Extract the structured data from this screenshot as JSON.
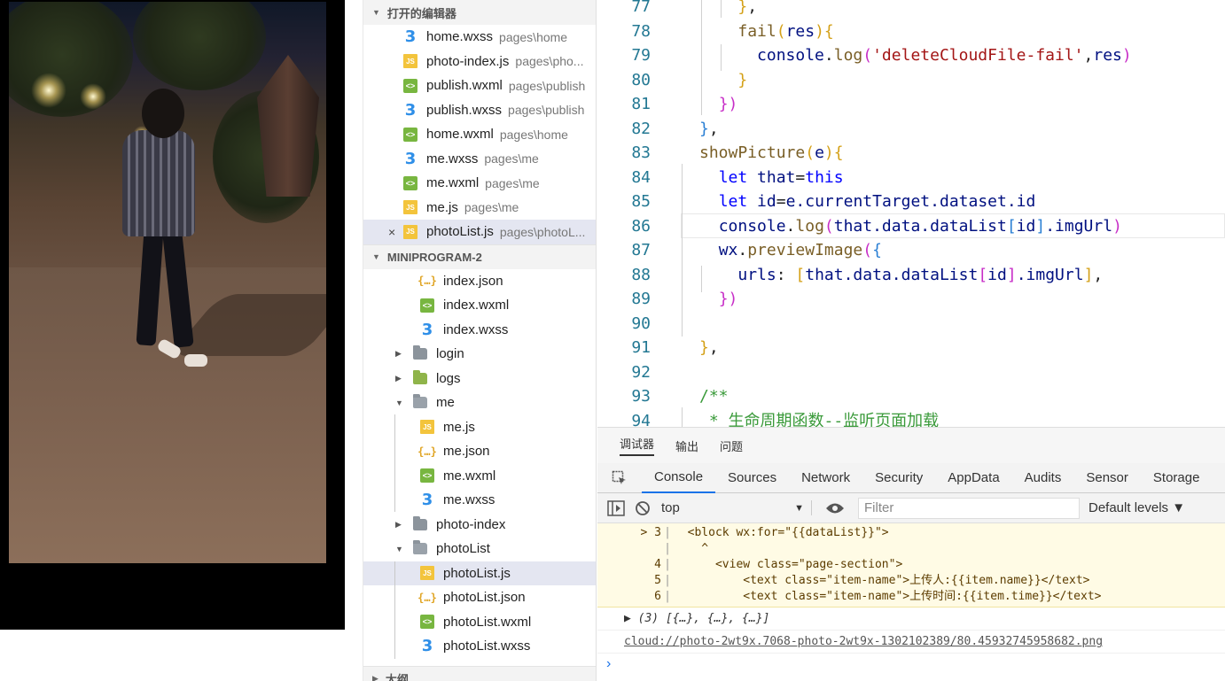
{
  "explorer": {
    "open_editors_label": "打开的编辑器",
    "open_editors": [
      {
        "name": "home.wxss",
        "path": "pages\\home",
        "type": "css"
      },
      {
        "name": "photo-index.js",
        "path": "pages\\pho...",
        "type": "js"
      },
      {
        "name": "publish.wxml",
        "path": "pages\\publish",
        "type": "wxml"
      },
      {
        "name": "publish.wxss",
        "path": "pages\\publish",
        "type": "css"
      },
      {
        "name": "home.wxml",
        "path": "pages\\home",
        "type": "wxml"
      },
      {
        "name": "me.wxss",
        "path": "pages\\me",
        "type": "css"
      },
      {
        "name": "me.wxml",
        "path": "pages\\me",
        "type": "wxml"
      },
      {
        "name": "me.js",
        "path": "pages\\me",
        "type": "js"
      },
      {
        "name": "photoList.js",
        "path": "pages\\photoL...",
        "type": "js",
        "active": true,
        "close": "×"
      }
    ],
    "project_label": "MINIPROGRAM-2",
    "tree": [
      {
        "name": "index.json",
        "type": "json",
        "depth": 2
      },
      {
        "name": "index.wxml",
        "type": "wxml",
        "depth": 2
      },
      {
        "name": "index.wxss",
        "type": "css",
        "depth": 2
      },
      {
        "name": "login",
        "type": "folder",
        "depth": 1,
        "twisty": "▶"
      },
      {
        "name": "logs",
        "type": "logs",
        "depth": 1,
        "twisty": "▶"
      },
      {
        "name": "me",
        "type": "folder-open",
        "depth": 1,
        "twisty": "▼"
      },
      {
        "name": "me.js",
        "type": "js",
        "depth": 2
      },
      {
        "name": "me.json",
        "type": "json",
        "depth": 2
      },
      {
        "name": "me.wxml",
        "type": "wxml",
        "depth": 2
      },
      {
        "name": "me.wxss",
        "type": "css",
        "depth": 2
      },
      {
        "name": "photo-index",
        "type": "folder",
        "depth": 1,
        "twisty": "▶"
      },
      {
        "name": "photoList",
        "type": "folder-open",
        "depth": 1,
        "twisty": "▼"
      },
      {
        "name": "photoList.js",
        "type": "js",
        "depth": 2,
        "selected": true
      },
      {
        "name": "photoList.json",
        "type": "json",
        "depth": 2
      },
      {
        "name": "photoList.wxml",
        "type": "wxml",
        "depth": 2
      },
      {
        "name": "photoList.wxss",
        "type": "css",
        "depth": 2
      }
    ],
    "outline_label": "大纲"
  },
  "editor": {
    "lines": [
      {
        "n": "77",
        "tokens": [
          [
            "    ",
            "t"
          ],
          [
            "}",
            "b1"
          ],
          [
            ",",
            "t"
          ]
        ]
      },
      {
        "n": "78",
        "tokens": [
          [
            "    ",
            "t"
          ],
          [
            "fail",
            "f"
          ],
          [
            "(",
            "b1"
          ],
          [
            "res",
            "p"
          ],
          [
            "){",
            "b1"
          ]
        ]
      },
      {
        "n": "79",
        "tokens": [
          [
            "      ",
            "t"
          ],
          [
            "console",
            "p"
          ],
          [
            ".",
            "t"
          ],
          [
            "log",
            "f"
          ],
          [
            "(",
            "b2"
          ],
          [
            "'deleteCloudFile-fail'",
            "s"
          ],
          [
            ",",
            "t"
          ],
          [
            "res",
            "p"
          ],
          [
            ")",
            "b2"
          ]
        ]
      },
      {
        "n": "80",
        "tokens": [
          [
            "    ",
            "t"
          ],
          [
            "}",
            "b1"
          ]
        ]
      },
      {
        "n": "81",
        "tokens": [
          [
            "  ",
            "t"
          ],
          [
            "})",
            "b2"
          ]
        ]
      },
      {
        "n": "82",
        "tokens": [
          [
            "}",
            "b3"
          ],
          [
            ",",
            "t"
          ]
        ]
      },
      {
        "n": "83",
        "tokens": [
          [
            "showPicture",
            "f"
          ],
          [
            "(",
            "b1"
          ],
          [
            "e",
            "p"
          ],
          [
            "){",
            "b1"
          ]
        ]
      },
      {
        "n": "84",
        "tokens": [
          [
            "  ",
            "t"
          ],
          [
            "let ",
            "k"
          ],
          [
            "that",
            "p"
          ],
          [
            "=",
            "t"
          ],
          [
            "this",
            "k"
          ]
        ]
      },
      {
        "n": "85",
        "tokens": [
          [
            "  ",
            "t"
          ],
          [
            "let ",
            "k"
          ],
          [
            "id",
            "p"
          ],
          [
            "=",
            "t"
          ],
          [
            "e",
            "p"
          ],
          [
            ".currentTarget.dataset.id",
            "p"
          ]
        ]
      },
      {
        "n": "86",
        "tokens": [
          [
            "  ",
            "t"
          ],
          [
            "console",
            "p"
          ],
          [
            ".",
            "t"
          ],
          [
            "log",
            "f"
          ],
          [
            "(",
            "b2"
          ],
          [
            "that.data.dataList",
            "p"
          ],
          [
            "[",
            "b3"
          ],
          [
            "id",
            "p"
          ],
          [
            "]",
            "b3"
          ],
          [
            ".imgUrl",
            "p"
          ],
          [
            ")",
            "b2"
          ]
        ]
      },
      {
        "n": "87",
        "tokens": [
          [
            "  ",
            "t"
          ],
          [
            "wx",
            "p"
          ],
          [
            ".",
            "t"
          ],
          [
            "previewImage",
            "f"
          ],
          [
            "(",
            "b2"
          ],
          [
            "{",
            "b3"
          ]
        ]
      },
      {
        "n": "88",
        "tokens": [
          [
            "    ",
            "t"
          ],
          [
            "urls",
            "p"
          ],
          [
            ": ",
            "t"
          ],
          [
            "[",
            "b1"
          ],
          [
            "that.data.dataList",
            "p"
          ],
          [
            "[",
            "b2"
          ],
          [
            "id",
            "p"
          ],
          [
            "]",
            "b2"
          ],
          [
            ".imgUrl",
            "p"
          ],
          [
            "]",
            "b1"
          ],
          [
            ",",
            "t"
          ]
        ]
      },
      {
        "n": "89",
        "tokens": [
          [
            "  ",
            "t"
          ],
          [
            "})",
            "b2"
          ]
        ]
      },
      {
        "n": "90",
        "tokens": []
      },
      {
        "n": "91",
        "tokens": [
          [
            "}",
            "b1"
          ],
          [
            ",",
            "t"
          ]
        ]
      },
      {
        "n": "92",
        "tokens": []
      },
      {
        "n": "93",
        "tokens": [
          [
            "/**",
            "cm"
          ]
        ]
      },
      {
        "n": "94",
        "tokens": [
          [
            " * 生命周期函数--监听页面加载",
            "cm"
          ]
        ]
      }
    ]
  },
  "panel": {
    "top_tabs": [
      "调试器",
      "输出",
      "问题"
    ],
    "devtools_tabs": [
      "Console",
      "Sources",
      "Network",
      "Security",
      "AppData",
      "Audits",
      "Sensor",
      "Storage"
    ],
    "context": "top",
    "filter_placeholder": "Filter",
    "levels": "Default levels ▼",
    "warning_lines": [
      {
        "gutter": "> 3",
        "text": "  <block wx:for=\"{{dataList}}\">"
      },
      {
        "gutter": "",
        "text": "    ^"
      },
      {
        "gutter": "4",
        "text": "      <view class=\"page-section\">"
      },
      {
        "gutter": "5",
        "text": "          <text class=\"item-name\">上传人:{{item.name}}</text>"
      },
      {
        "gutter": "6",
        "text": "          <text class=\"item-name\">上传时间:{{item.time}}</text>"
      }
    ],
    "array_log": "▶ (3) [{…}, {…}, {…}]",
    "url_log": "cloud://photo-2wt9x.7068-photo-2wt9x-1302102389/80.45932745958682.png",
    "prompt": "›"
  }
}
